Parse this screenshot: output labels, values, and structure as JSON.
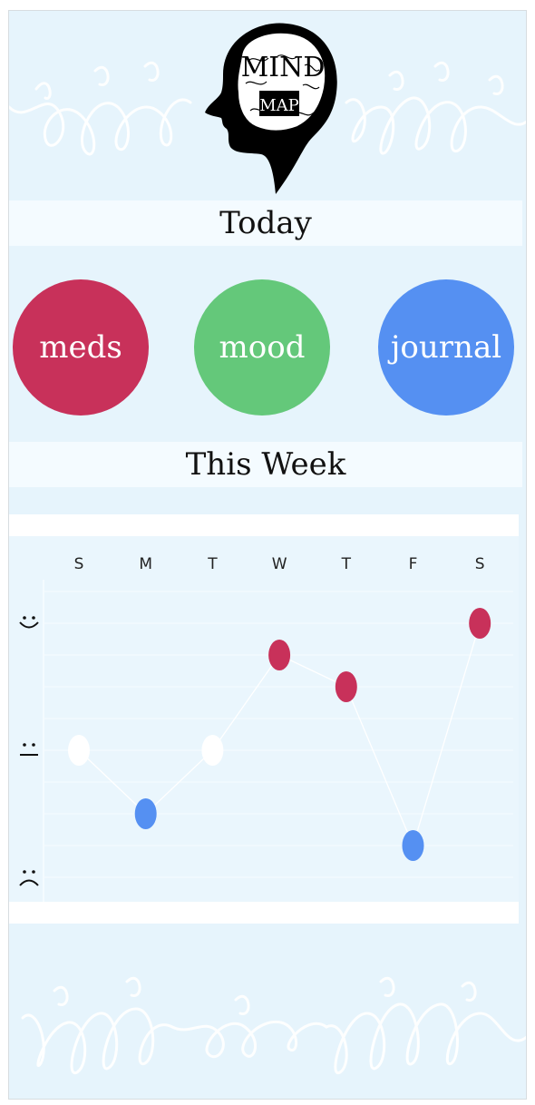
{
  "app": {
    "logo_text_top": "MIND",
    "logo_text_bottom": "MAP"
  },
  "today": {
    "title": "Today"
  },
  "actions": [
    {
      "label": "meds",
      "color": "#c8315a"
    },
    {
      "label": "mood",
      "color": "#64c87a"
    },
    {
      "label": "journal",
      "color": "#5590f2"
    }
  ],
  "week": {
    "title": "This Week"
  },
  "chart_data": {
    "type": "line",
    "categories": [
      "S",
      "M",
      "T",
      "W",
      "T",
      "F",
      "S"
    ],
    "y_labels": [
      "happy",
      "neutral",
      "sad"
    ],
    "ylim": [
      -1,
      1
    ],
    "values": [
      0,
      -0.5,
      0,
      0.75,
      0.5,
      -0.75,
      1
    ],
    "point_colors": [
      "#ffffff",
      "#5590f2",
      "#ffffff",
      "#c8315a",
      "#c8315a",
      "#5590f2",
      "#c8315a"
    ],
    "grid": true,
    "line_color": "#ffffff"
  }
}
